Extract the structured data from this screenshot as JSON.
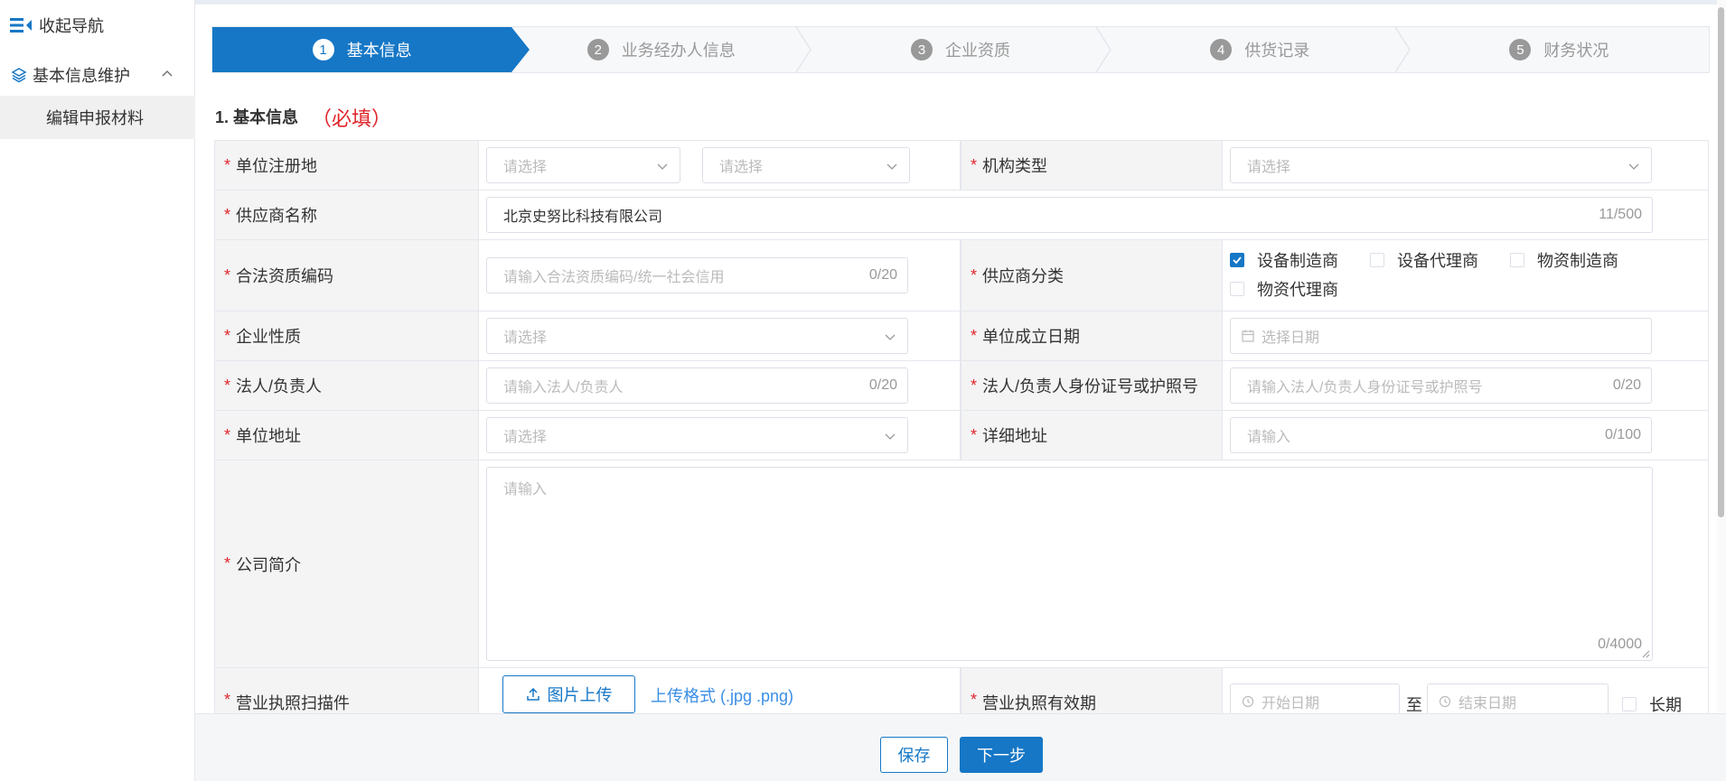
{
  "sidebar": {
    "collapse_label": "收起导航",
    "group_label": "基本信息维护",
    "item_label": "编辑申报材料"
  },
  "steps": [
    {
      "num": "1",
      "label": "基本信息",
      "active": true
    },
    {
      "num": "2",
      "label": "业务经办人信息",
      "active": false
    },
    {
      "num": "3",
      "label": "企业资质",
      "active": false
    },
    {
      "num": "4",
      "label": "供货记录",
      "active": false
    },
    {
      "num": "5",
      "label": "财务状况",
      "active": false
    }
  ],
  "section": {
    "title": "1. 基本信息",
    "required_note": "（必填）"
  },
  "form": {
    "reg_place": {
      "label": "单位注册地",
      "select1_placeholder": "请选择",
      "select2_placeholder": "请选择"
    },
    "org_type": {
      "label": "机构类型",
      "placeholder": "请选择"
    },
    "supplier_name": {
      "label": "供应商名称",
      "value": "北京史努比科技有限公司",
      "count": "11/500"
    },
    "legal_code": {
      "label": "合法资质编码",
      "placeholder": "请输入合法资质编码/统一社会信用",
      "count": "0/20"
    },
    "supplier_class": {
      "label": "供应商分类",
      "options": [
        {
          "label": "设备制造商",
          "checked": true
        },
        {
          "label": "设备代理商",
          "checked": false
        },
        {
          "label": "物资制造商",
          "checked": false
        },
        {
          "label": "物资代理商",
          "checked": false
        }
      ]
    },
    "enterprise_nature": {
      "label": "企业性质",
      "placeholder": "请选择"
    },
    "founded_date": {
      "label": "单位成立日期",
      "placeholder": "选择日期"
    },
    "legal_person": {
      "label": "法人/负责人",
      "placeholder": "请输入法人/负责人",
      "count": "0/20"
    },
    "legal_id": {
      "label": "法人/负责人身份证号或护照号",
      "placeholder": "请输入法人/负责人身份证号或护照号",
      "count": "0/20"
    },
    "address": {
      "label": "单位地址",
      "placeholder": "请选择"
    },
    "detail_address": {
      "label": "详细地址",
      "placeholder": "请输入",
      "count": "0/100"
    },
    "intro": {
      "label": "公司简介",
      "placeholder": "请输入",
      "count": "0/4000"
    },
    "license_scan": {
      "label": "营业执照扫描件",
      "upload_label": "图片上传",
      "hint": "上传格式 (.jpg .png)"
    },
    "license_valid": {
      "label": "营业执照有效期",
      "start_placeholder": "开始日期",
      "to": "至",
      "end_placeholder": "结束日期",
      "long_term": "长期"
    }
  },
  "footer": {
    "save_label": "保存",
    "next_label": "下一步"
  },
  "colors": {
    "primary": "#1677c6",
    "required": "#e0252b",
    "label_bg": "#f4f4f5"
  }
}
